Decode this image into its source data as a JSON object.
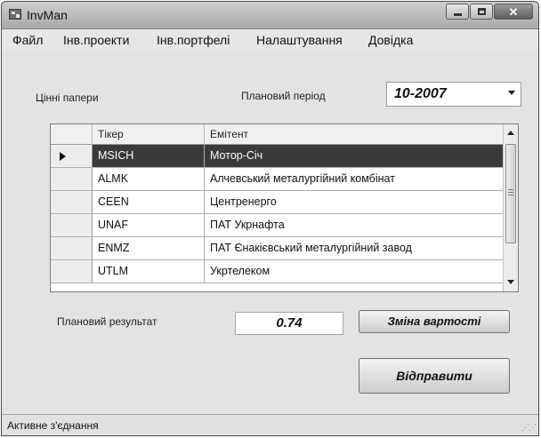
{
  "window": {
    "title": "InvMan"
  },
  "menu": {
    "items": [
      "Файл",
      "Інв.проекти",
      "Інв.портфелі",
      "Налаштування",
      "Довідка"
    ]
  },
  "securities_label": "Цінні папери",
  "period": {
    "label": "Плановий період",
    "value": "10-2007"
  },
  "grid": {
    "columns": [
      "Тікер",
      "Емітент"
    ],
    "rows": [
      {
        "ticker": "MSICH",
        "issuer": "Мотор-Січ",
        "selected": true
      },
      {
        "ticker": "ALMK",
        "issuer": "Алчевський металургійний комбінат"
      },
      {
        "ticker": "CEEN",
        "issuer": "Центренерго"
      },
      {
        "ticker": "UNAF",
        "issuer": "ПАТ Укрнафта"
      },
      {
        "ticker": "ENMZ",
        "issuer": "ПАТ Єнакієвський металургійний завод"
      },
      {
        "ticker": "UTLM",
        "issuer": "Укртелеком"
      }
    ]
  },
  "result": {
    "label": "Плановий результат",
    "value": "0.74"
  },
  "buttons": {
    "change_value": "Зміна вартості",
    "send": "Відправити"
  },
  "status": {
    "text": "Активне з'єднання"
  }
}
